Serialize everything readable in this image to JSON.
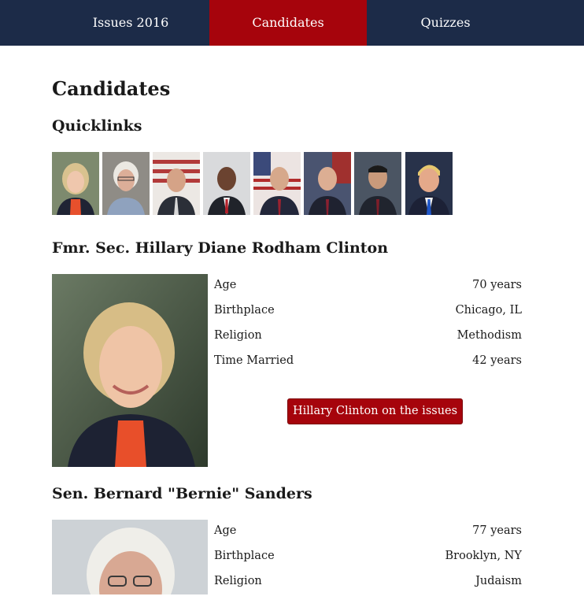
{
  "nav": {
    "tabs": [
      {
        "label": "Issues 2016",
        "active": false
      },
      {
        "label": "Candidates",
        "active": true
      },
      {
        "label": "Quizzes",
        "active": false
      }
    ],
    "colors": {
      "bar": "#1c2b48",
      "active": "#a6040c"
    }
  },
  "page": {
    "title": "Candidates",
    "quicklinks_heading": "Quicklinks"
  },
  "quicklinks": [
    {
      "icon": "candidate-photo-1"
    },
    {
      "icon": "candidate-photo-2"
    },
    {
      "icon": "candidate-photo-3"
    },
    {
      "icon": "candidate-photo-4"
    },
    {
      "icon": "candidate-photo-5"
    },
    {
      "icon": "candidate-photo-6"
    },
    {
      "icon": "candidate-photo-7"
    },
    {
      "icon": "candidate-photo-8"
    }
  ],
  "candidates": [
    {
      "name": "Fmr. Sec. Hillary Diane Rodham Clinton",
      "facts": [
        {
          "label": "Age",
          "value": "70 years"
        },
        {
          "label": "Birthplace",
          "value": "Chicago, IL"
        },
        {
          "label": "Religion",
          "value": "Methodism"
        },
        {
          "label": "Time Married",
          "value": "42 years"
        }
      ],
      "issues_button": "Hillary Clinton on the issues"
    },
    {
      "name": "Sen. Bernard \"Bernie\" Sanders",
      "facts": [
        {
          "label": "Age",
          "value": "77 years"
        },
        {
          "label": "Birthplace",
          "value": "Brooklyn, NY"
        },
        {
          "label": "Religion",
          "value": "Judaism"
        }
      ]
    }
  ]
}
